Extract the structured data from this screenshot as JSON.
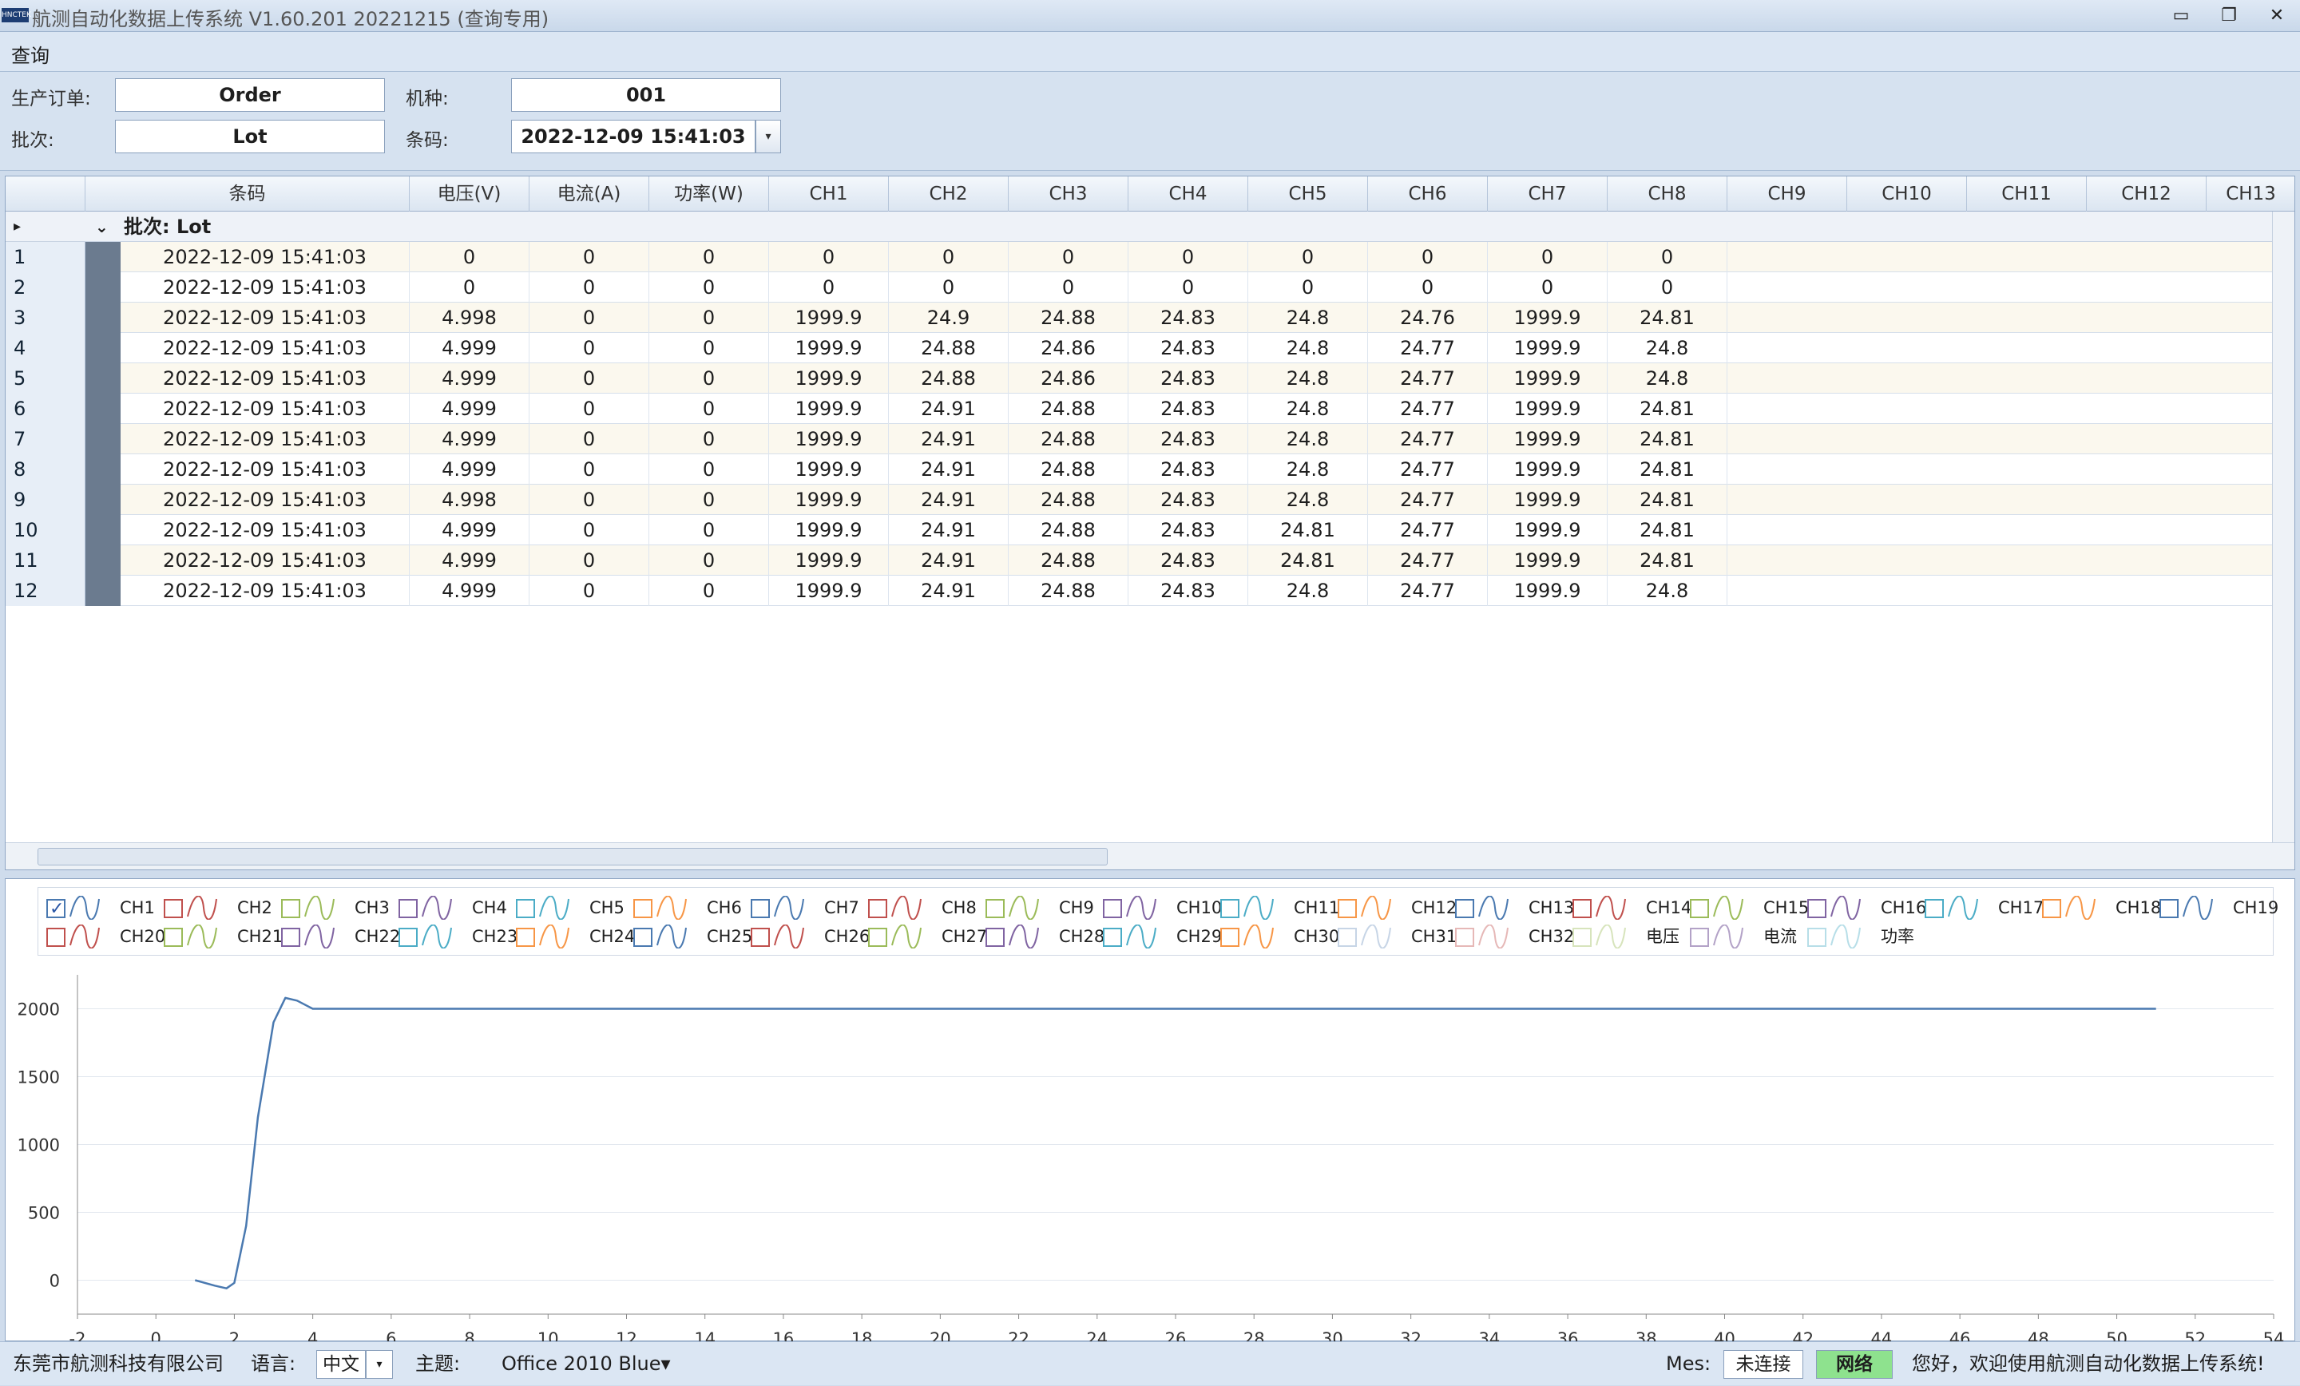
{
  "window": {
    "title": "航测自动化数据上传系统  V1.60.201 20221215 (查询专用)",
    "logo_text": "HNCTEK",
    "min": "▭",
    "restore": "❐",
    "close": "✕"
  },
  "menu": {
    "query": "查询"
  },
  "form": {
    "order_label": "生产订单:",
    "order_value": "Order",
    "model_label": "机种:",
    "model_value": "001",
    "batch_label": "批次:",
    "batch_value": "Lot",
    "barcode_label": "条码:",
    "barcode_value": "2022-12-09 15:41:03",
    "barcode_dd": "▾"
  },
  "grid": {
    "headers": [
      "条码",
      "电压(V)",
      "电流(A)",
      "功率(W)",
      "CH1",
      "CH2",
      "CH3",
      "CH4",
      "CH5",
      "CH6",
      "CH7",
      "CH8",
      "CH9",
      "CH10",
      "CH11",
      "CH12",
      "CH13"
    ],
    "group": "批次: Lot",
    "group_expand": "⌄",
    "arrow": "▸",
    "rows": [
      {
        "n": "1",
        "v": [
          "2022-12-09 15:41:03",
          "0",
          "0",
          "0",
          "0",
          "0",
          "0",
          "0",
          "0",
          "0",
          "0",
          "0"
        ]
      },
      {
        "n": "2",
        "v": [
          "2022-12-09 15:41:03",
          "0",
          "0",
          "0",
          "0",
          "0",
          "0",
          "0",
          "0",
          "0",
          "0",
          "0"
        ]
      },
      {
        "n": "3",
        "v": [
          "2022-12-09 15:41:03",
          "4.998",
          "0",
          "0",
          "1999.9",
          "24.9",
          "24.88",
          "24.83",
          "24.8",
          "24.76",
          "1999.9",
          "24.81"
        ]
      },
      {
        "n": "4",
        "v": [
          "2022-12-09 15:41:03",
          "4.999",
          "0",
          "0",
          "1999.9",
          "24.88",
          "24.86",
          "24.83",
          "24.8",
          "24.77",
          "1999.9",
          "24.8"
        ]
      },
      {
        "n": "5",
        "v": [
          "2022-12-09 15:41:03",
          "4.999",
          "0",
          "0",
          "1999.9",
          "24.88",
          "24.86",
          "24.83",
          "24.8",
          "24.77",
          "1999.9",
          "24.8"
        ]
      },
      {
        "n": "6",
        "v": [
          "2022-12-09 15:41:03",
          "4.999",
          "0",
          "0",
          "1999.9",
          "24.91",
          "24.88",
          "24.83",
          "24.8",
          "24.77",
          "1999.9",
          "24.81"
        ]
      },
      {
        "n": "7",
        "v": [
          "2022-12-09 15:41:03",
          "4.999",
          "0",
          "0",
          "1999.9",
          "24.91",
          "24.88",
          "24.83",
          "24.8",
          "24.77",
          "1999.9",
          "24.81"
        ]
      },
      {
        "n": "8",
        "v": [
          "2022-12-09 15:41:03",
          "4.999",
          "0",
          "0",
          "1999.9",
          "24.91",
          "24.88",
          "24.83",
          "24.8",
          "24.77",
          "1999.9",
          "24.81"
        ]
      },
      {
        "n": "9",
        "v": [
          "2022-12-09 15:41:03",
          "4.998",
          "0",
          "0",
          "1999.9",
          "24.91",
          "24.88",
          "24.83",
          "24.8",
          "24.77",
          "1999.9",
          "24.81"
        ]
      },
      {
        "n": "10",
        "v": [
          "2022-12-09 15:41:03",
          "4.999",
          "0",
          "0",
          "1999.9",
          "24.91",
          "24.88",
          "24.83",
          "24.81",
          "24.77",
          "1999.9",
          "24.81"
        ]
      },
      {
        "n": "11",
        "v": [
          "2022-12-09 15:41:03",
          "4.999",
          "0",
          "0",
          "1999.9",
          "24.91",
          "24.88",
          "24.83",
          "24.81",
          "24.77",
          "1999.9",
          "24.81"
        ]
      },
      {
        "n": "12",
        "v": [
          "2022-12-09 15:41:03",
          "4.999",
          "0",
          "0",
          "1999.9",
          "24.91",
          "24.88",
          "24.83",
          "24.8",
          "24.77",
          "1999.9",
          "24.8"
        ]
      }
    ]
  },
  "legend": [
    {
      "label": "CH1",
      "color": "#4a79b0",
      "checked": true
    },
    {
      "label": "CH2",
      "color": "#c0504d"
    },
    {
      "label": "CH3",
      "color": "#9bbb59"
    },
    {
      "label": "CH4",
      "color": "#8064a2"
    },
    {
      "label": "CH5",
      "color": "#4bacc6"
    },
    {
      "label": "CH6",
      "color": "#f79646"
    },
    {
      "label": "CH7",
      "color": "#4a79b0"
    },
    {
      "label": "CH8",
      "color": "#c0504d"
    },
    {
      "label": "CH9",
      "color": "#9bbb59"
    },
    {
      "label": "CH10",
      "color": "#8064a2"
    },
    {
      "label": "CH11",
      "color": "#4bacc6"
    },
    {
      "label": "CH12",
      "color": "#f79646"
    },
    {
      "label": "CH13",
      "color": "#4a79b0"
    },
    {
      "label": "CH14",
      "color": "#c0504d"
    },
    {
      "label": "CH15",
      "color": "#9bbb59"
    },
    {
      "label": "CH16",
      "color": "#8064a2"
    },
    {
      "label": "CH17",
      "color": "#4bacc6"
    },
    {
      "label": "CH18",
      "color": "#f79646"
    },
    {
      "label": "CH19",
      "color": "#4a79b0"
    },
    {
      "label": "CH20",
      "color": "#c0504d"
    },
    {
      "label": "CH21",
      "color": "#9bbb59"
    },
    {
      "label": "CH22",
      "color": "#8064a2"
    },
    {
      "label": "CH23",
      "color": "#4bacc6"
    },
    {
      "label": "CH24",
      "color": "#f79646"
    },
    {
      "label": "CH25",
      "color": "#4a79b0"
    },
    {
      "label": "CH26",
      "color": "#c0504d"
    },
    {
      "label": "CH27",
      "color": "#9bbb59"
    },
    {
      "label": "CH28",
      "color": "#8064a2"
    },
    {
      "label": "CH29",
      "color": "#4bacc6"
    },
    {
      "label": "CH30",
      "color": "#f79646"
    },
    {
      "label": "CH31",
      "color": "#c7d5e6"
    },
    {
      "label": "CH32",
      "color": "#e6b8b7"
    },
    {
      "label": "电压",
      "color": "#d7e4bc"
    },
    {
      "label": "电流",
      "color": "#b3a2c7"
    },
    {
      "label": "功率",
      "color": "#b7dee8"
    }
  ],
  "chart_data": {
    "type": "line",
    "title": "",
    "xlabel": "",
    "ylabel": "",
    "xlim": [
      -2,
      54
    ],
    "ylim": [
      -250,
      2250
    ],
    "xticks": [
      "-2",
      "0",
      "2",
      "4",
      "6",
      "8",
      "10",
      "12",
      "14",
      "16",
      "18",
      "20",
      "22",
      "24",
      "26",
      "28",
      "30",
      "32",
      "34",
      "36",
      "38",
      "40",
      "42",
      "44",
      "46",
      "48",
      "50",
      "52",
      "54"
    ],
    "yticks": [
      "0",
      "500",
      "1000",
      "1500",
      "2000"
    ],
    "grid": true,
    "series": [
      {
        "x": [
          1,
          1.5,
          1.8,
          2,
          2.3,
          2.6,
          3,
          3.3,
          3.6,
          4,
          6,
          10,
          20,
          30,
          40,
          51
        ],
        "y": [
          0,
          -40,
          -60,
          -20,
          400,
          1200,
          1900,
          2080,
          2060,
          2000,
          2000,
          2000,
          2000,
          2000,
          2000,
          2000
        ]
      }
    ]
  },
  "status": {
    "company": "东莞市航测科技有限公司",
    "lang_label": "语言:",
    "lang_value": "中文",
    "lang_dd": "▾",
    "theme_label": "主题:",
    "theme_value": "Office 2010 Blue▾",
    "mes_label": "Mes:",
    "mes_value": "未连接",
    "net": "网络",
    "welcome": "您好，欢迎使用航测自动化数据上传系统!"
  }
}
